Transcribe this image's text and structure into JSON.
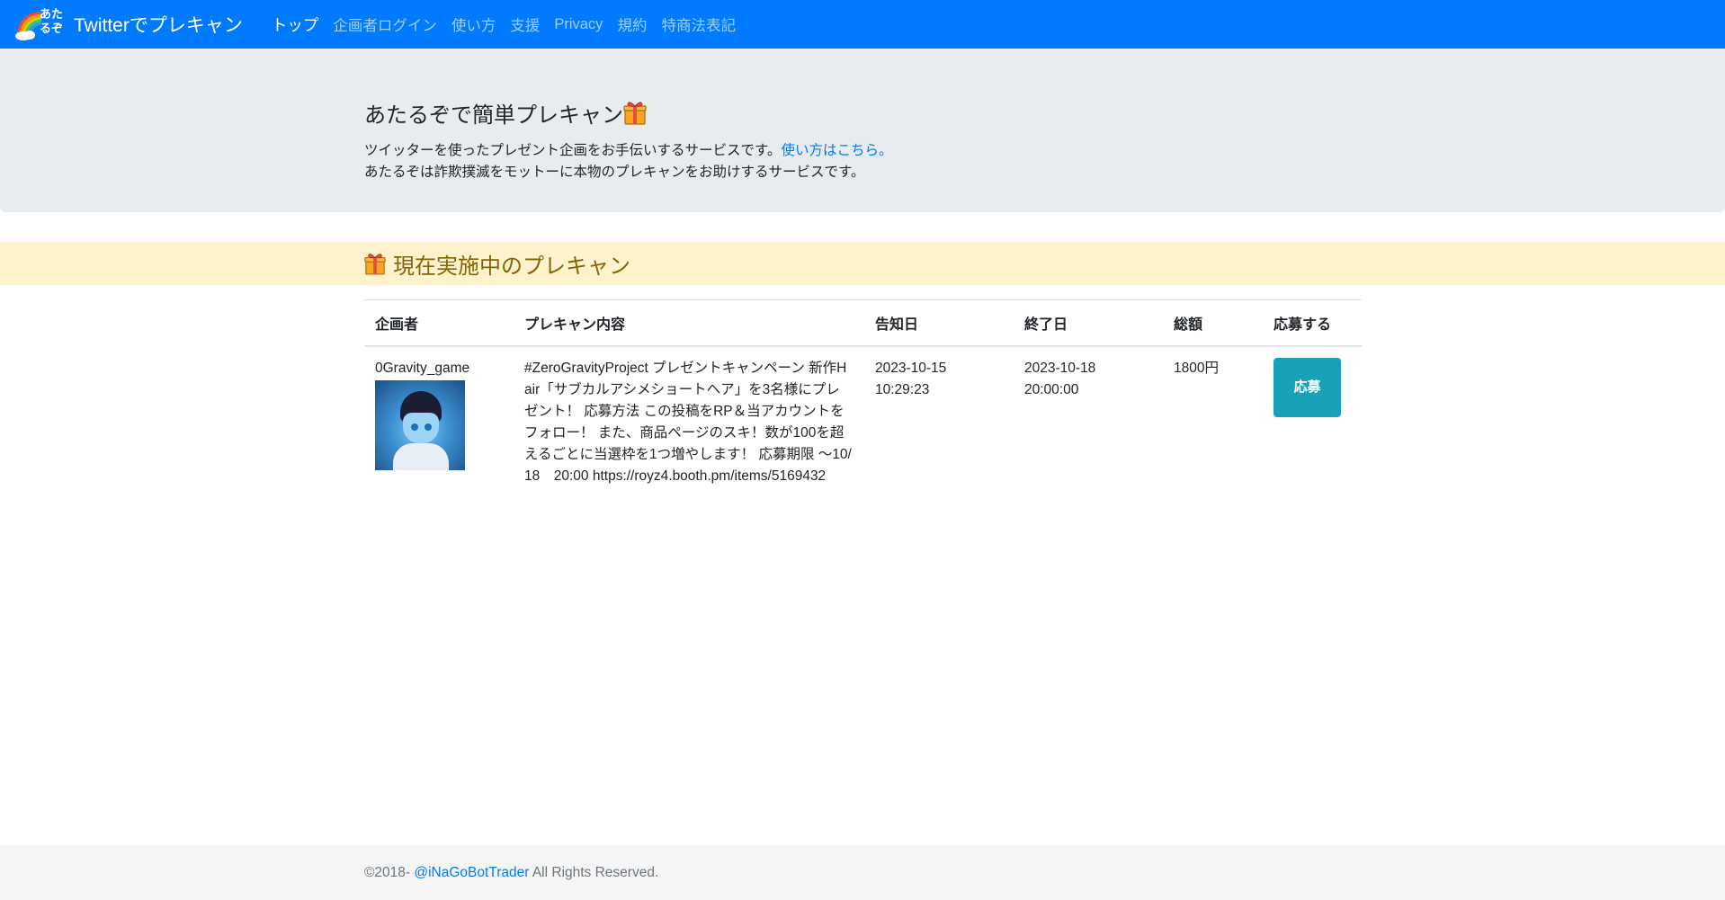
{
  "navbar": {
    "logo_text": "あたるぞ",
    "brand": "Twitterでプレキャン",
    "links": [
      {
        "label": "トップ",
        "active": true
      },
      {
        "label": "企画者ログイン",
        "active": false
      },
      {
        "label": "使い方",
        "active": false
      },
      {
        "label": "支援",
        "active": false
      },
      {
        "label": "Privacy",
        "active": false
      },
      {
        "label": "規約",
        "active": false
      },
      {
        "label": "特商法表記",
        "active": false
      }
    ]
  },
  "jumbotron": {
    "title": "あたるぞで簡単プレキャン",
    "line1": "ツイッターを使ったプレゼント企画をお手伝いするサービスです。",
    "line1_link": "使い方はこちら。",
    "line2": "あたるぞは詐欺撲滅をモットーに本物のプレキャンをお助けするサービスです。"
  },
  "section": {
    "title": "現在実施中のプレキャン"
  },
  "table": {
    "headers": [
      "企画者",
      "プレキャン内容",
      "告知日",
      "終了日",
      "総額",
      "応募する"
    ],
    "rows": [
      {
        "organizer": "0Gravity_game",
        "content": "#ZeroGravityProject プレゼントキャンペーン 新作Hair「サブカルアシメショートヘア」を3名様にプレゼント！ 応募方法 この投稿をRP＆当アカウントをフォロー！ また、商品ページのスキ！数が100を超えるごとに当選枠を1つ増やします！ 応募期限 〜10/18　20:00 https://royz4.booth.pm/items/5169432",
        "announce_date": "2023-10-15",
        "announce_time": "10:29:23",
        "end_date": "2023-10-18",
        "end_time": "20:00:00",
        "total": "1800円",
        "apply_label": "応募"
      }
    ]
  },
  "footer": {
    "prefix": "©2018- ",
    "link": "@iNaGoBotTrader",
    "suffix": " All Rights Reserved."
  },
  "colors": {
    "navbar": "#007bff",
    "jumbotron": "#e9ecef",
    "section_band": "#fff3cd",
    "section_text": "#856404",
    "apply_button": "#17a2b8",
    "footer": "#f5f5f5"
  },
  "icons": [
    "rainbow-cloud-logo",
    "gift-icon"
  ]
}
